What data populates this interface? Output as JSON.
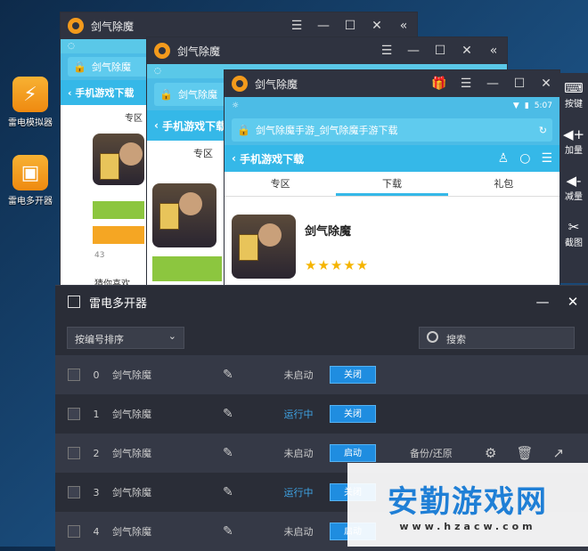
{
  "desktop": {
    "icons": [
      {
        "label": "雷电模拟器"
      },
      {
        "label": "雷电多开器"
      }
    ]
  },
  "windows": {
    "w1": {
      "title": "剑气除魔",
      "status": "◌",
      "addr_title": "剑气除魔",
      "nav": "手机游戏下载",
      "tab": "专区",
      "count": "43",
      "footer": "猜你喜欢"
    },
    "w2": {
      "title": "剑气除魔",
      "status": "◌",
      "addr_title": "剑气除魔",
      "nav": "手机游戏下载",
      "tab": "专区"
    },
    "w3": {
      "title": "剑气除魔",
      "time": "5:07",
      "address": "剑气除魔手游_剑气除魔手游下载",
      "nav": "手机游戏下载",
      "tabs": [
        "专区",
        "下载",
        "礼包"
      ],
      "game_name": "剑气除魔",
      "stars": "★★★★★"
    }
  },
  "sidebar": {
    "items": [
      {
        "label": "按键",
        "icon": "⌨"
      },
      {
        "label": "加量",
        "icon": "◀+"
      },
      {
        "label": "减量",
        "icon": "◀-"
      },
      {
        "label": "截图",
        "icon": "✂"
      }
    ]
  },
  "panel": {
    "title": "雷电多开器",
    "sort": "按编号排序",
    "search": "搜索",
    "backup": "备份/还原",
    "rows": [
      {
        "index": "0",
        "name": "剑气除魔",
        "status": "未启动",
        "action": "关闭"
      },
      {
        "index": "1",
        "name": "剑气除魔",
        "status": "运行中",
        "action": "关闭"
      },
      {
        "index": "2",
        "name": "剑气除魔",
        "status": "未启动",
        "action": "启动"
      },
      {
        "index": "3",
        "name": "剑气除魔",
        "status": "运行中",
        "action": "关闭"
      },
      {
        "index": "4",
        "name": "剑气除魔",
        "status": "未启动",
        "action": "启动"
      }
    ]
  },
  "watermark": {
    "title": "安勤游戏网",
    "url": "www.hzacw.com"
  }
}
